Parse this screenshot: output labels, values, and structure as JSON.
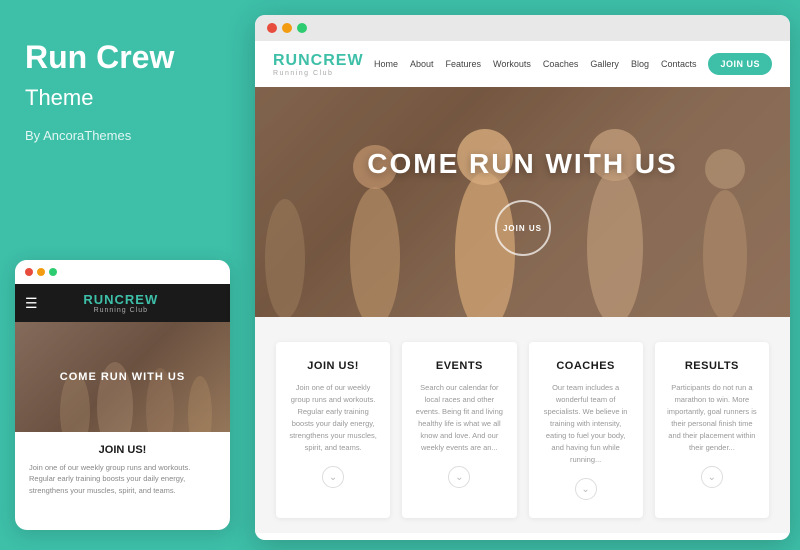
{
  "left": {
    "title": "Run Crew",
    "subtitle": "Theme",
    "by": "By AncoraThemes"
  },
  "mobile": {
    "dots": [
      "#e74c3c",
      "#f39c12",
      "#2ecc71"
    ],
    "logo": "RUNCREW",
    "logo_sub": "Running Club",
    "hero_text": "COME RUN WITH US",
    "card_title": "JOIN US!",
    "card_text": "Join one of our weekly group runs and workouts. Regular early training boosts your daily energy, strengthens your muscles, spirit, and teams."
  },
  "browser": {
    "dots": [
      "#e74c3c",
      "#f39c12",
      "#2ecc71"
    ],
    "navbar": {
      "logo": "RUNCREW",
      "logo_sub": "Running Club",
      "links": [
        "Home",
        "About",
        "Features",
        "Workouts",
        "Coaches",
        "Gallery",
        "Blog",
        "Contacts"
      ],
      "join_btn": "JOIN US"
    },
    "hero": {
      "headline": "COME RUN WITH US",
      "join_btn": "JOIN US"
    },
    "cards": [
      {
        "title": "JOIN US!",
        "text": "Join one of our weekly group runs and workouts. Regular early training boosts your daily energy, strengthens your muscles, spirit, and teams."
      },
      {
        "title": "EVENTS",
        "text": "Search our calendar for local races and other events. Being fit and living healthy life is what we all know and love. And our weekly events are an..."
      },
      {
        "title": "COACHES",
        "text": "Our team includes a wonderful team of specialists. We believe in training with intensity, eating to fuel your body, and having fun while running..."
      },
      {
        "title": "RESULTS",
        "text": "Participants do not run a marathon to win. More importantly, goal runners is their personal finish time and their placement within their gender..."
      }
    ]
  },
  "colors": {
    "teal": "#3dbfa8",
    "dark": "#1a1a1a",
    "text_gray": "#999",
    "hero_bg": "#8a7060"
  }
}
